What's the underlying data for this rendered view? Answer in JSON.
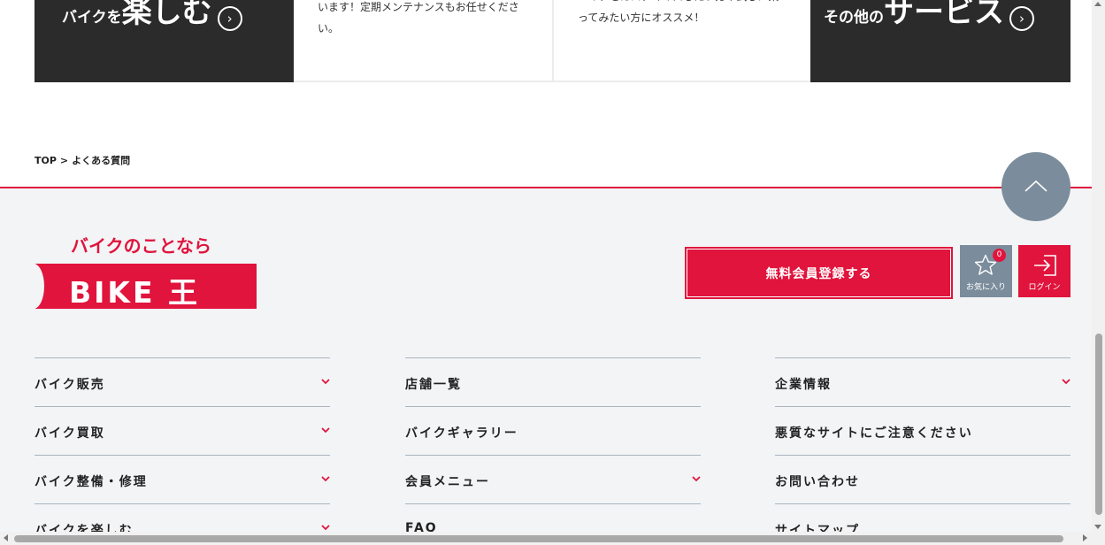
{
  "cards": {
    "enjoy": {
      "small": "バイクを",
      "big": "楽しむ"
    },
    "maintenance_desc": "います！定期メンテナンスもお任せください。",
    "rental_desc_line1": "バイクをカスタマイズしたい方や試しに乗",
    "rental_desc_line2": "ってみたい方にオススメ！",
    "other": {
      "small": "その他の",
      "big": "サービス"
    }
  },
  "breadcrumb": {
    "top": "TOP",
    "separator": ">",
    "current": "よくある質問"
  },
  "logo": {
    "tagline": "バイクのことなら",
    "wordmark": "BIKE 王"
  },
  "actions": {
    "register": "無料会員登録する",
    "favorites_label": "お気に入り",
    "favorites_count": "0",
    "login_label": "ログイン"
  },
  "nav": {
    "col1": [
      "バイク販売",
      "バイク買取",
      "バイク整備・修理",
      "バイクを楽しむ"
    ],
    "col2": [
      "店舗一覧",
      "バイクギャラリー",
      "会員メニュー",
      "FAQ"
    ],
    "col3": [
      "企業情報",
      "悪質なサイトにご注意ください",
      "お問い合わせ",
      "サイトマップ"
    ]
  },
  "colors": {
    "accent": "#e0143c",
    "slate": "#7b8c9c",
    "dark": "#2b2b2b",
    "footer_bg": "#f3f4f6"
  }
}
